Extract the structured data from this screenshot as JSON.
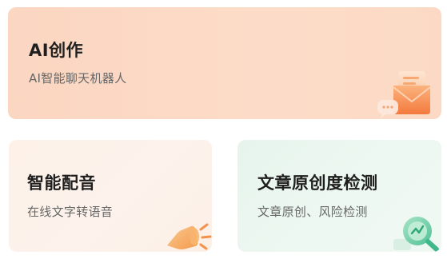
{
  "cards": [
    {
      "id": "ai-create",
      "title": "AI创作",
      "subtitle": "AI智能聊天机器人",
      "icon": "envelope-chat-icon",
      "accent": "#f4894f"
    },
    {
      "id": "voice-dub",
      "title": "智能配音",
      "subtitle": "在线文字转语音",
      "icon": "speaker-icon",
      "accent": "#f6a25b"
    },
    {
      "id": "originality-check",
      "title": "文章原创度检测",
      "subtitle": "文章原创、风险检测",
      "icon": "magnifier-check-icon",
      "accent": "#3fb98a"
    }
  ]
}
